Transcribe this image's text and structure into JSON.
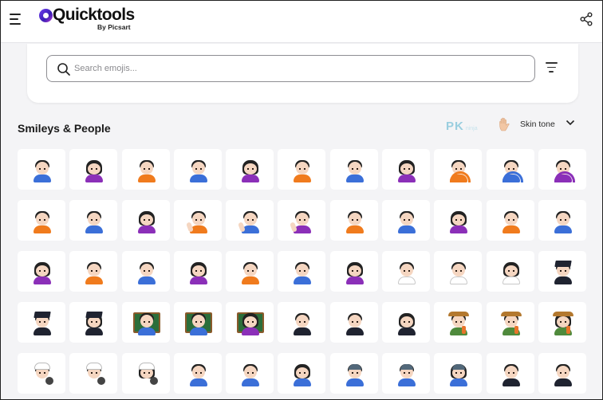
{
  "header": {
    "logo_text": "Quicktools",
    "logo_sub": "By Picsart"
  },
  "search": {
    "placeholder": "Search emojis..."
  },
  "section": {
    "title": "Smileys & People",
    "watermark": "PK",
    "watermark_small": "ninja",
    "skin_tone_label": "Skin tone"
  },
  "colors": {
    "accent": "#6f3cf0",
    "tile_bg": "#ffffff",
    "page_bg": "#f4f4f6"
  },
  "emoji_rows": [
    [
      {
        "name": "man-frowning",
        "kind": "man",
        "shirt": "#3b6fd8"
      },
      {
        "name": "woman-frowning",
        "kind": "woman",
        "shirt": "#8b2fb8"
      },
      {
        "name": "person-pouting",
        "kind": "man",
        "shirt": "#f07b1d"
      },
      {
        "name": "man-pouting",
        "kind": "man",
        "shirt": "#3b6fd8"
      },
      {
        "name": "woman-pouting",
        "kind": "woman",
        "shirt": "#8b2fb8"
      },
      {
        "name": "person-gesturing-no",
        "kind": "man",
        "shirt": "#f07b1d"
      },
      {
        "name": "man-gesturing-no",
        "kind": "man",
        "shirt": "#3b6fd8"
      },
      {
        "name": "woman-gesturing-no",
        "kind": "woman",
        "shirt": "#8b2fb8"
      },
      {
        "name": "person-gesturing-ok",
        "kind": "ok",
        "shirt": "#f07b1d"
      },
      {
        "name": "man-gesturing-ok",
        "kind": "ok",
        "shirt": "#3b6fd8"
      },
      {
        "name": "woman-gesturing-ok",
        "kind": "ok",
        "shirt": "#8b2fb8"
      }
    ],
    [
      {
        "name": "person-tipping-hand",
        "kind": "man",
        "shirt": "#f07b1d"
      },
      {
        "name": "man-tipping-hand",
        "kind": "man",
        "shirt": "#3b6fd8"
      },
      {
        "name": "woman-tipping-hand",
        "kind": "woman",
        "shirt": "#8b2fb8"
      },
      {
        "name": "person-raising-hand",
        "kind": "raise",
        "shirt": "#f07b1d"
      },
      {
        "name": "man-raising-hand",
        "kind": "raise",
        "shirt": "#3b6fd8"
      },
      {
        "name": "woman-raising-hand",
        "kind": "raise",
        "shirt": "#8b2fb8"
      },
      {
        "name": "deaf-person",
        "kind": "man",
        "shirt": "#f07b1d"
      },
      {
        "name": "deaf-man",
        "kind": "man",
        "shirt": "#3b6fd8"
      },
      {
        "name": "deaf-woman",
        "kind": "woman",
        "shirt": "#8b2fb8"
      },
      {
        "name": "person-bowing",
        "kind": "man",
        "shirt": "#f07b1d"
      },
      {
        "name": "man-bowing",
        "kind": "man",
        "shirt": "#3b6fd8"
      }
    ],
    [
      {
        "name": "woman-bowing",
        "kind": "woman",
        "shirt": "#8b2fb8"
      },
      {
        "name": "person-facepalming",
        "kind": "man",
        "shirt": "#f07b1d"
      },
      {
        "name": "man-facepalming",
        "kind": "man",
        "shirt": "#3b6fd8"
      },
      {
        "name": "woman-facepalming",
        "kind": "woman",
        "shirt": "#8b2fb8"
      },
      {
        "name": "person-shrugging",
        "kind": "man",
        "shirt": "#f07b1d"
      },
      {
        "name": "man-shrugging",
        "kind": "man",
        "shirt": "#3b6fd8"
      },
      {
        "name": "woman-shrugging",
        "kind": "woman",
        "shirt": "#8b2fb8"
      },
      {
        "name": "health-worker",
        "kind": "doc",
        "shirt": "#ffffff"
      },
      {
        "name": "man-health-worker",
        "kind": "doc",
        "shirt": "#ffffff"
      },
      {
        "name": "woman-health-worker",
        "kind": "woman doc",
        "shirt": "#ffffff"
      },
      {
        "name": "student",
        "kind": "grad",
        "shirt": "#1f2330"
      }
    ],
    [
      {
        "name": "man-student",
        "kind": "grad",
        "shirt": "#1f2330"
      },
      {
        "name": "woman-student",
        "kind": "woman grad",
        "shirt": "#1f2330"
      },
      {
        "name": "teacher",
        "kind": "teach",
        "shirt": "#3b6fd8"
      },
      {
        "name": "man-teacher",
        "kind": "teach",
        "shirt": "#3b6fd8"
      },
      {
        "name": "woman-teacher",
        "kind": "woman teach",
        "shirt": "#8b2fb8"
      },
      {
        "name": "judge",
        "kind": "man",
        "shirt": "#1f2330"
      },
      {
        "name": "man-judge",
        "kind": "man",
        "shirt": "#1f2330"
      },
      {
        "name": "woman-judge",
        "kind": "woman",
        "shirt": "#1f2330"
      },
      {
        "name": "farmer",
        "kind": "farm",
        "shirt": "#4f8a3c"
      },
      {
        "name": "man-farmer",
        "kind": "farm",
        "shirt": "#4f8a3c"
      },
      {
        "name": "woman-farmer",
        "kind": "woman farm",
        "shirt": "#4f8a3c"
      }
    ],
    [
      {
        "name": "cook",
        "kind": "chef",
        "shirt": "#ffffff"
      },
      {
        "name": "man-cook",
        "kind": "chef",
        "shirt": "#ffffff"
      },
      {
        "name": "woman-cook",
        "kind": "woman chef",
        "shirt": "#ffffff"
      },
      {
        "name": "mechanic",
        "kind": "man",
        "shirt": "#3b6fd8"
      },
      {
        "name": "man-mechanic",
        "kind": "man",
        "shirt": "#3b6fd8"
      },
      {
        "name": "woman-mechanic",
        "kind": "woman",
        "shirt": "#3b6fd8"
      },
      {
        "name": "factory-worker",
        "kind": "tech",
        "shirt": "#3b6fd8"
      },
      {
        "name": "man-factory-worker",
        "kind": "tech",
        "shirt": "#3b6fd8"
      },
      {
        "name": "woman-factory-worker",
        "kind": "woman tech",
        "shirt": "#3b6fd8"
      },
      {
        "name": "office-worker",
        "kind": "man",
        "shirt": "#1f2330"
      },
      {
        "name": "man-office-worker",
        "kind": "man",
        "shirt": "#1f2330"
      }
    ]
  ]
}
